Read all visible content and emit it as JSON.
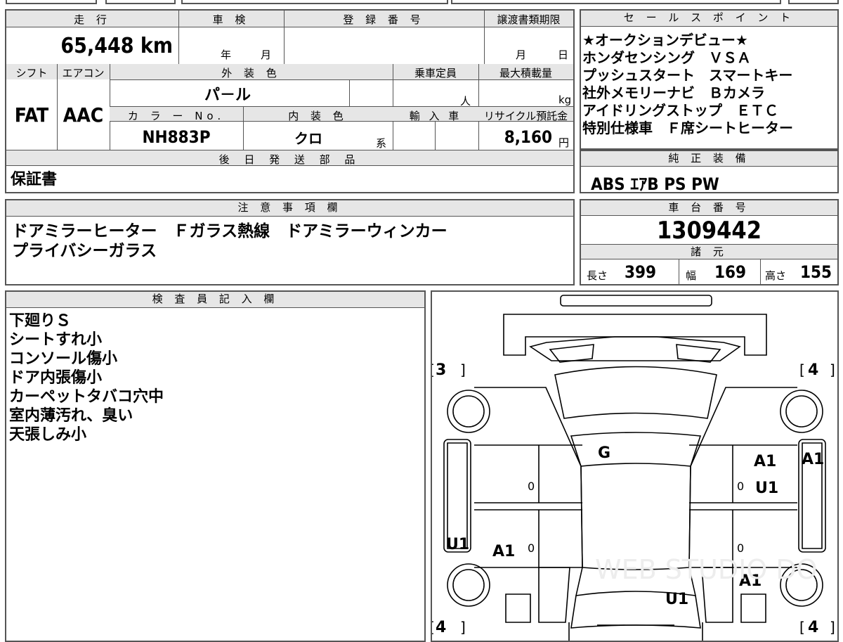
{
  "top_summary": {
    "mileage_label": "走 行",
    "mileage_value": "65,448 km",
    "inspection_label": "車 検",
    "inspection_year_unit": "年",
    "inspection_month_unit": "月",
    "registration_label": "登 録 番 号",
    "transfer_deadline_label": "譲渡書類期限",
    "transfer_month_unit": "月",
    "transfer_day_unit": "日",
    "shift_label": "シフト",
    "shift_value": "FAT",
    "aircon_label": "エアコン",
    "aircon_value": "AAC",
    "exterior_color_label": "外 装 色",
    "exterior_color_value": "パ－ル",
    "capacity_label": "乗車定員",
    "capacity_unit": "人",
    "max_load_label": "最大積載量",
    "max_load_unit": "kg",
    "color_no_label": "カ ラ ー No.",
    "color_no_value": "NH883P",
    "interior_color_label": "内 装 色",
    "interior_color_value": "クロ",
    "interior_color_suffix": "系",
    "import_label": "輸 入 車",
    "recycle_label": "リサイクル預託金",
    "recycle_value": "8,160",
    "recycle_unit": "円",
    "later_parts_label": "後 日 発 送 部 品",
    "later_parts_value": "保証書"
  },
  "sales_points": {
    "title": "セ ー ル ス ポ イ ン ト",
    "lines": [
      "★オークションデビュー★",
      "ホンダセンシング　ＶＳＡ",
      "プッシュスタート　スマートキー",
      "社外メモリーナビ　Ｂカメラ",
      "アイドリングストップ　ＥＴＣ",
      "特別仕様車　Ｆ席シートヒーター"
    ]
  },
  "genuine_equipment": {
    "title": "純 正 装 備",
    "value": "ABS ｴｱB PS PW"
  },
  "notes": {
    "title": "注 意 事 項 欄",
    "lines": [
      "ドアミラーヒーター　Ｆガラス熱線　ドアミラーウィンカー",
      "プライバシーガラス"
    ]
  },
  "chassis": {
    "title": "車 台 番 号",
    "value": "1309442"
  },
  "dimensions": {
    "title": "諸 元",
    "length_label": "長さ",
    "length_value": "399",
    "width_label": "幅",
    "width_value": "169",
    "height_label": "高さ",
    "height_value": "155"
  },
  "inspector": {
    "title": "検 査 員 記 入 欄",
    "lines": [
      "下廻りＳ",
      "シートすれ小",
      "コンソール傷小",
      "ドア内張傷小",
      "カーペットタバコ穴中",
      "室内薄汚れ、臭い",
      "天張しみ小"
    ]
  },
  "diagram": {
    "tread_front_left": "3",
    "tread_front_right": "4",
    "tread_rear_left": "4",
    "tread_rear_right": "4",
    "marks": {
      "windshield": "G",
      "right_front_door": "A1",
      "right_front_door_2": "U1",
      "right_fender": "A1",
      "left_rear_door": "A1",
      "left_quarter": "U1",
      "right_rear": "A1",
      "rear_center": "U1"
    },
    "zeros": [
      "0",
      "0",
      "0",
      "0"
    ],
    "watermark": "WEB STUDIO DO"
  }
}
